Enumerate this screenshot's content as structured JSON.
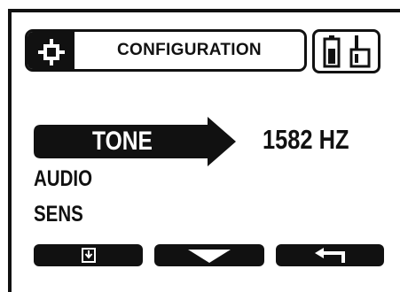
{
  "header": {
    "title": "CONFIGURATION",
    "mode_icon": "crosshair-icon",
    "status_icons": [
      "battery-icon",
      "transmitter-icon"
    ]
  },
  "menu": {
    "selected": {
      "label": "TONE",
      "value": "1582 HZ"
    },
    "items": [
      {
        "label": "AUDIO"
      },
      {
        "label": "SENS"
      }
    ]
  },
  "softkeys": [
    {
      "icon": "save-icon"
    },
    {
      "icon": "down-arrow-icon"
    },
    {
      "icon": "back-arrow-icon"
    }
  ],
  "colors": {
    "foreground": "#111111",
    "background": "#ffffff"
  }
}
